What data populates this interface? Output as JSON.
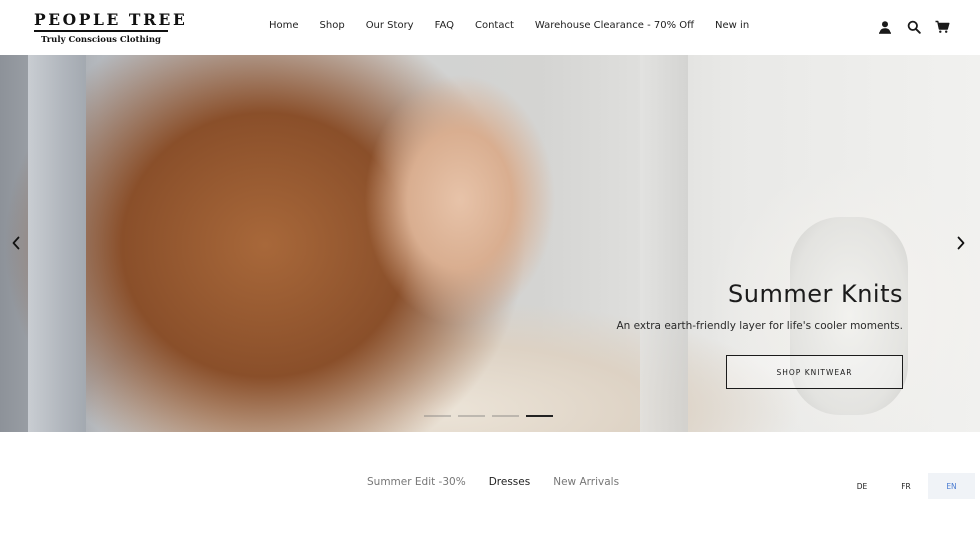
{
  "header": {
    "logo_title": "PEOPLE TREE",
    "logo_subtitle": "Truly Conscious Clothing",
    "nav": [
      "Home",
      "Shop",
      "Our Story",
      "FAQ",
      "Contact",
      "Warehouse Clearance - 70% Off",
      "New in"
    ],
    "icons": [
      "account-icon",
      "search-icon",
      "cart-icon"
    ]
  },
  "hero": {
    "title": "Summer Knits",
    "subtitle": "An extra earth-friendly layer for life's cooler moments.",
    "button_label": "SHOP KNITWEAR",
    "slide_count": 4,
    "active_slide": 4
  },
  "tabs": {
    "items": [
      "Summer Edit -30%",
      "Dresses",
      "New Arrivals"
    ],
    "active": "Dresses"
  },
  "languages": {
    "items": [
      "DE",
      "FR",
      "EN"
    ],
    "active": "EN",
    "active_color": "#4a7bd1"
  }
}
